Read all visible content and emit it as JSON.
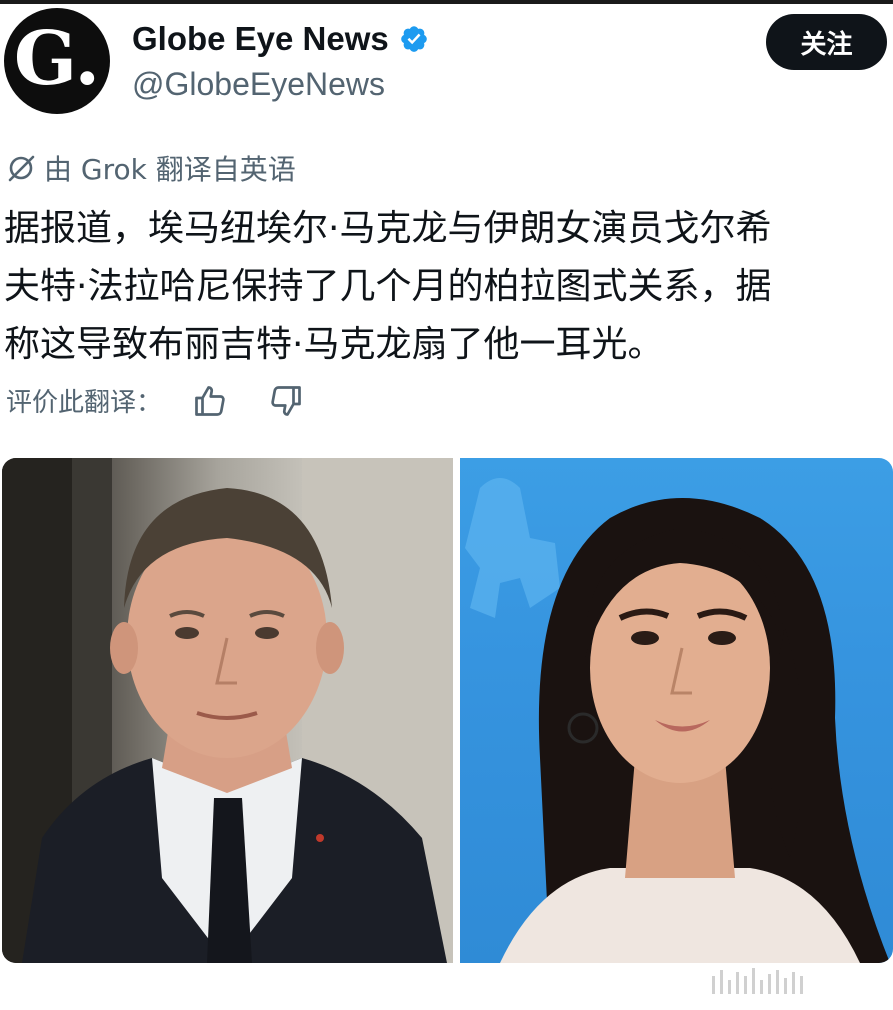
{
  "account": {
    "avatar_letter": "G.",
    "display_name": "Globe Eye News",
    "handle": "@GlobeEyeNews",
    "verified_icon": "verified-badge-icon",
    "verified_color": "#1d9bf0"
  },
  "follow_button": {
    "label": "关注"
  },
  "translation": {
    "note": "由 Grok 翻译自英语",
    "rate_label": "评价此翻译：",
    "thumbs_up_icon": "thumbs-up-icon",
    "thumbs_down_icon": "thumbs-down-icon"
  },
  "post": {
    "lines": [
      "据报道，埃马纽埃尔·马克龙与伊朗女演员戈尔希",
      "夫特·法拉哈尼保持了几个月的柏拉图式关系，据",
      "称这导致布丽吉特·马克龙扇了他一耳光。"
    ]
  },
  "media": {
    "count": 2
  },
  "colors": {
    "text": "#0f1419",
    "secondary": "#536471",
    "button_bg": "#0f1419"
  }
}
